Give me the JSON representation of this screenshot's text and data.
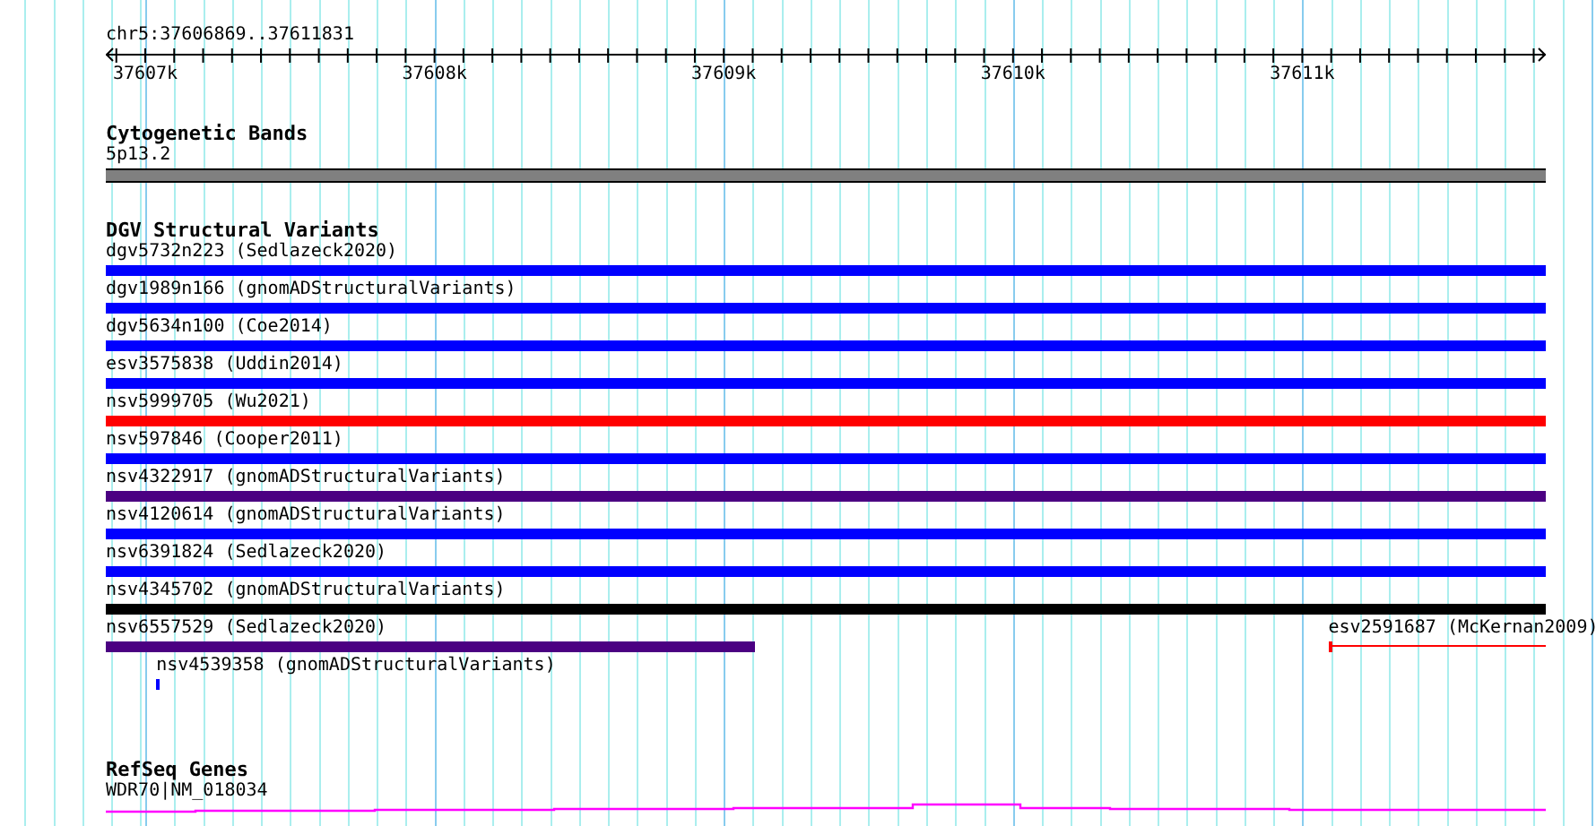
{
  "ruler": {
    "location": "chr5:37606869..37611831",
    "ticks": [
      "37607k",
      "37608k",
      "37609k",
      "37610k",
      "37611k"
    ]
  },
  "tracks": [
    {
      "kind": "bands",
      "title": "Cytogenetic Bands",
      "rows": [
        [
          {
            "kind": "band",
            "label": "5p13.2",
            "color": "#808080"
          }
        ]
      ]
    },
    {
      "kind": "variants",
      "title": "DGV Structural Variants",
      "rows": [
        [
          {
            "kind": "bar",
            "label": "dgv5732n223 (Sedlazeck2020)",
            "color": "#0000ff"
          }
        ],
        [
          {
            "kind": "bar",
            "label": "dgv1989n166 (gnomADStructuralVariants)",
            "color": "#0000ff"
          }
        ],
        [
          {
            "kind": "bar",
            "label": "dgv5634n100 (Coe2014)",
            "color": "#0000ff"
          }
        ],
        [
          {
            "kind": "bar",
            "label": "esv3575838 (Uddin2014)",
            "color": "#0000ff"
          }
        ],
        [
          {
            "kind": "bar",
            "label": "nsv5999705 (Wu2021)",
            "color": "#ff0000"
          }
        ],
        [
          {
            "kind": "bar",
            "label": "nsv597846 (Cooper2011)",
            "color": "#0000ff"
          }
        ],
        [
          {
            "kind": "bar",
            "label": "nsv4322917 (gnomADStructuralVariants)",
            "color": "#4b0082"
          }
        ],
        [
          {
            "kind": "bar",
            "label": "nsv4120614 (gnomADStructuralVariants)",
            "color": "#0000ff"
          }
        ],
        [
          {
            "kind": "bar",
            "label": "nsv6391824 (Sedlazeck2020)",
            "color": "#0000ff"
          }
        ],
        [
          {
            "kind": "bar",
            "label": "nsv4345702 (gnomADStructuralVariants)",
            "color": "#000000"
          }
        ],
        [
          {
            "kind": "bar-left",
            "label": "nsv6557529 (Sedlazeck2020)",
            "color": "#4b0082"
          },
          {
            "kind": "line-right",
            "label": "esv2591687 (McKernan2009)",
            "color": "#ff0000"
          }
        ],
        [
          {
            "kind": "point",
            "label": "nsv4539358 (gnomADStructuralVariants)",
            "color": "#0000ff"
          }
        ]
      ]
    },
    {
      "kind": "genes",
      "title": "RefSeq Genes",
      "rows": [
        [
          {
            "kind": "gene",
            "label": "WDR70|NM_018034",
            "color": "#ff00ff"
          }
        ]
      ]
    }
  ]
}
